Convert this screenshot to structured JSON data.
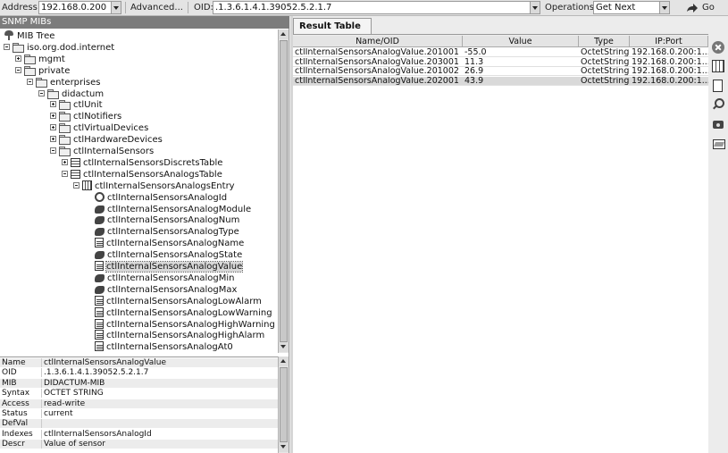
{
  "toolbar": {
    "address_label": "Address:",
    "address_value": "192.168.0.200",
    "advanced_label": "Advanced...",
    "oid_label": "OID:",
    "oid_value": ".1.3.6.1.4.1.39052.5.2.1.7",
    "operations_label": "Operations:",
    "operations_value": "Get Next",
    "go_label": "Go"
  },
  "left_panel": {
    "header": "SNMP MIBs",
    "tree": [
      {
        "label": "MIB Tree",
        "icon": "tree-icon",
        "level": 0,
        "expander": "none"
      },
      {
        "label": "iso.org.dod.internet",
        "icon": "folder-icon",
        "level": 0,
        "expander": "minus"
      },
      {
        "label": "mgmt",
        "icon": "folder-icon",
        "level": 1,
        "expander": "plus"
      },
      {
        "label": "private",
        "icon": "folder-icon",
        "level": 1,
        "expander": "minus"
      },
      {
        "label": "enterprises",
        "icon": "folder-icon",
        "level": 2,
        "expander": "minus"
      },
      {
        "label": "didactum",
        "icon": "folder-icon",
        "level": 3,
        "expander": "minus"
      },
      {
        "label": "ctlUnit",
        "icon": "folder-icon",
        "level": 4,
        "expander": "plus"
      },
      {
        "label": "ctlNotifiers",
        "icon": "folder-icon",
        "level": 4,
        "expander": "plus"
      },
      {
        "label": "ctlVirtualDevices",
        "icon": "folder-icon",
        "level": 4,
        "expander": "plus"
      },
      {
        "label": "ctlHardwareDevices",
        "icon": "folder-icon",
        "level": 4,
        "expander": "plus"
      },
      {
        "label": "ctlInternalSensors",
        "icon": "folder-icon",
        "level": 4,
        "expander": "minus"
      },
      {
        "label": "ctlInternalSensorsDiscretsTable",
        "icon": "table-icon",
        "level": 5,
        "expander": "plus"
      },
      {
        "label": "ctlInternalSensorsAnalogsTable",
        "icon": "table-icon",
        "level": 5,
        "expander": "minus"
      },
      {
        "label": "ctlInternalSensorsAnalogsEntry",
        "icon": "entry-icon",
        "level": 6,
        "expander": "minus"
      },
      {
        "label": "ctlInternalSensorsAnalogId",
        "icon": "key-icon",
        "level": 7,
        "expander": "none"
      },
      {
        "label": "ctlInternalSensorsAnalogModule",
        "icon": "leaf-icon",
        "level": 7,
        "expander": "none"
      },
      {
        "label": "ctlInternalSensorsAnalogNum",
        "icon": "leaf-icon",
        "level": 7,
        "expander": "none"
      },
      {
        "label": "ctlInternalSensorsAnalogType",
        "icon": "leaf-icon",
        "level": 7,
        "expander": "none"
      },
      {
        "label": "ctlInternalSensorsAnalogName",
        "icon": "doc-icon",
        "level": 7,
        "expander": "none"
      },
      {
        "label": "ctlInternalSensorsAnalogState",
        "icon": "leaf-icon",
        "level": 7,
        "expander": "none"
      },
      {
        "label": "ctlInternalSensorsAnalogValue",
        "icon": "doc-icon",
        "level": 7,
        "expander": "none",
        "selected": true
      },
      {
        "label": "ctlInternalSensorsAnalogMin",
        "icon": "leaf-icon",
        "level": 7,
        "expander": "none"
      },
      {
        "label": "ctlInternalSensorsAnalogMax",
        "icon": "leaf-icon",
        "level": 7,
        "expander": "none"
      },
      {
        "label": "ctlInternalSensorsAnalogLowAlarm",
        "icon": "doc-icon",
        "level": 7,
        "expander": "none"
      },
      {
        "label": "ctlInternalSensorsAnalogLowWarning",
        "icon": "doc-icon",
        "level": 7,
        "expander": "none"
      },
      {
        "label": "ctlInternalSensorsAnalogHighWarning",
        "icon": "doc-icon",
        "level": 7,
        "expander": "none"
      },
      {
        "label": "ctlInternalSensorsAnalogHighAlarm",
        "icon": "doc-icon",
        "level": 7,
        "expander": "none"
      },
      {
        "label": "ctlInternalSensorsAnalogAt0",
        "icon": "doc-icon",
        "level": 7,
        "expander": "none"
      }
    ],
    "properties": [
      {
        "key": "Name",
        "value": "ctlInternalSensorsAnalogValue"
      },
      {
        "key": "OID",
        "value": ".1.3.6.1.4.1.39052.5.2.1.7"
      },
      {
        "key": "MIB",
        "value": "DIDACTUM-MIB"
      },
      {
        "key": "Syntax",
        "value": "OCTET STRING"
      },
      {
        "key": "Access",
        "value": "read-write"
      },
      {
        "key": "Status",
        "value": "current"
      },
      {
        "key": "DefVal",
        "value": ""
      },
      {
        "key": "Indexes",
        "value": "ctlInternalSensorsAnalogId"
      },
      {
        "key": "Descr",
        "value": "Value of sensor"
      }
    ]
  },
  "result": {
    "tab_label": "Result Table",
    "columns": [
      "Name/OID",
      "Value",
      "Type",
      "IP:Port"
    ],
    "rows": [
      [
        "ctlInternalSensorsAnalogValue.201001",
        "-55.0",
        "OctetString",
        "192.168.0.200:1..."
      ],
      [
        "ctlInternalSensorsAnalogValue.203001",
        "11.3",
        "OctetString",
        "192.168.0.200:1..."
      ],
      [
        "ctlInternalSensorsAnalogValue.201002",
        "26.9",
        "OctetString",
        "192.168.0.200:1..."
      ],
      [
        "ctlInternalSensorsAnalogValue.202001",
        "43.9",
        "OctetString",
        "192.168.0.200:1..."
      ]
    ]
  },
  "side_toolbar": [
    "close-icon",
    "table-icon",
    "page-icon",
    "magnifier-icon",
    "camera-icon",
    "open-folder-icon"
  ]
}
